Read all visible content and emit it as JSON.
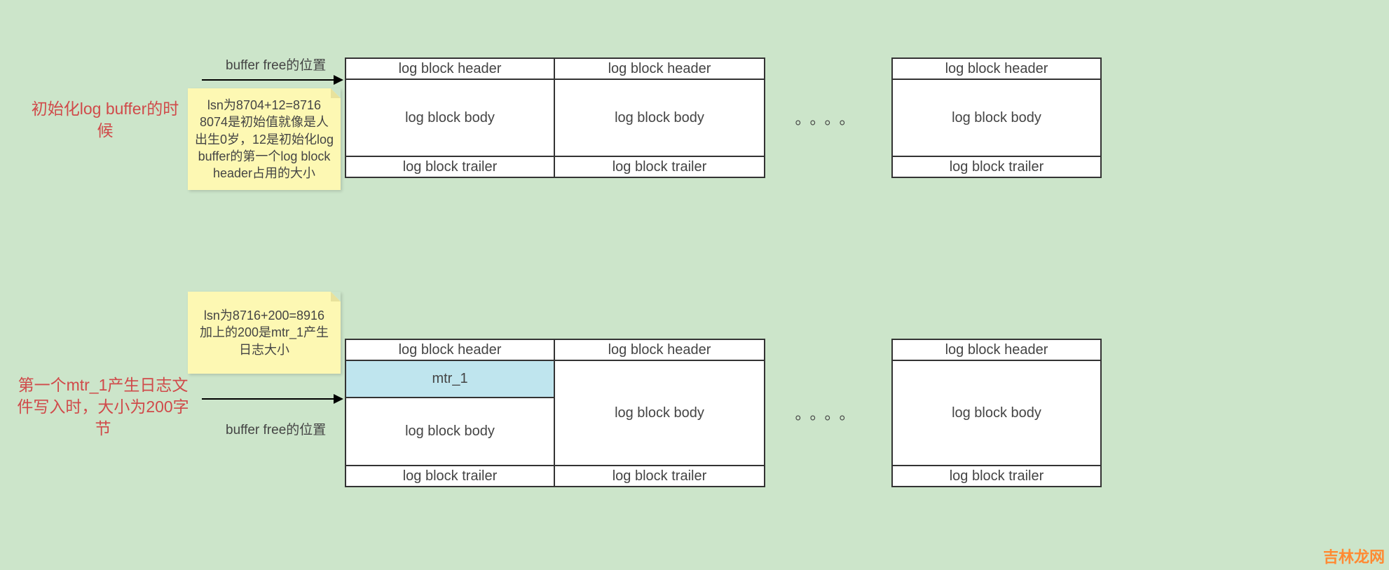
{
  "section1": {
    "red_label": "初始化log buffer的时候",
    "note": "lsn为8704+12=8716\n8074是初始值就像是人出生0岁，12是初始化log buffer的第一个log block header占用的大小",
    "arrow_label": "buffer free的位置",
    "block": {
      "header": "log block header",
      "body": "log block body",
      "trailer": "log block trailer"
    },
    "ellipsis": "。。。。"
  },
  "section2": {
    "red_label": "第一个mtr_1产生日志文件写入时，大小为200字节",
    "note": "lsn为8716+200=8916\n加上的200是mtr_1产生日志大小",
    "arrow_label": "buffer free的位置",
    "block": {
      "header": "log block header",
      "body": "log block body",
      "trailer": "log block trailer",
      "mtr": "mtr_1"
    },
    "ellipsis": "。。。。"
  },
  "watermark": "吉林龙网"
}
